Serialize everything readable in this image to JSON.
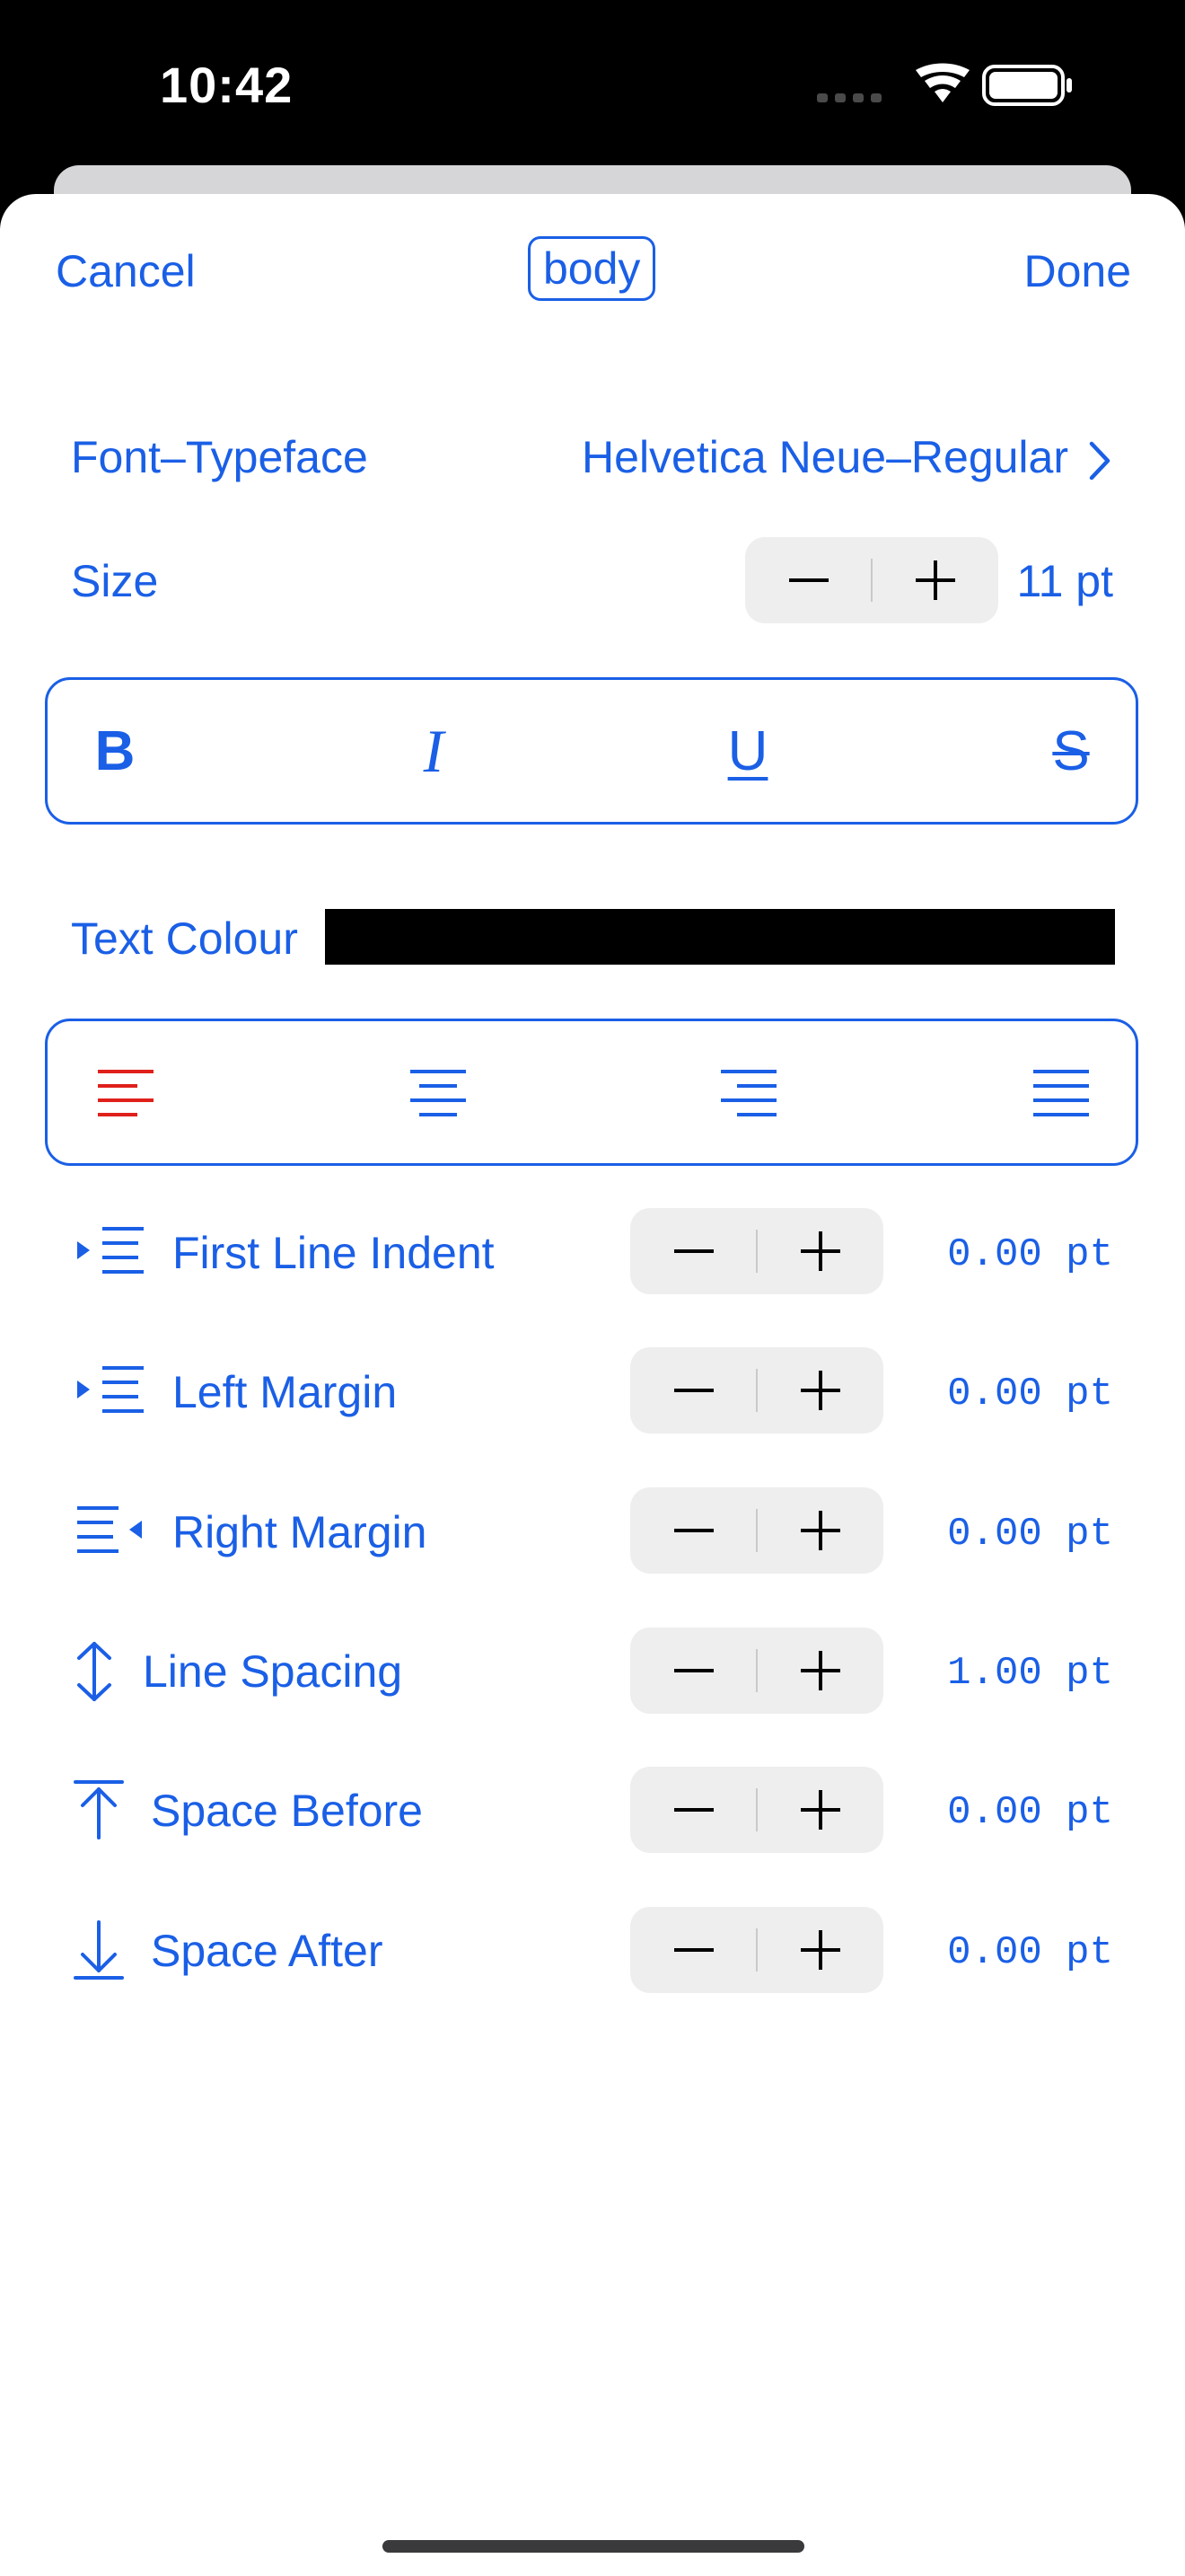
{
  "status_bar": {
    "time": "10:42"
  },
  "nav": {
    "cancel": "Cancel",
    "title": "body",
    "done": "Done"
  },
  "font": {
    "label": "Font–Typeface",
    "value": "Helvetica Neue–Regular"
  },
  "size": {
    "label": "Size",
    "value": "11 pt"
  },
  "format_buttons": {
    "bold": "B",
    "italic": "I",
    "underline": "U",
    "strike": "S"
  },
  "text_colour": {
    "label": "Text Colour",
    "color": "#000000"
  },
  "alignment": {
    "selected": "left",
    "options": [
      "left",
      "center",
      "right",
      "justify"
    ],
    "selected_color": "#e0201b"
  },
  "paragraph": [
    {
      "label": "First Line Indent",
      "value": "0.00 pt",
      "icon": "first-line-indent-icon"
    },
    {
      "label": "Left Margin",
      "value": "0.00 pt",
      "icon": "left-margin-icon"
    },
    {
      "label": "Right Margin",
      "value": "0.00 pt",
      "icon": "right-margin-icon"
    },
    {
      "label": "Line Spacing",
      "value": "1.00 pt",
      "icon": "line-spacing-icon"
    },
    {
      "label": "Space Before",
      "value": "0.00 pt",
      "icon": "space-before-icon"
    },
    {
      "label": "Space After",
      "value": "0.00 pt",
      "icon": "space-after-icon"
    }
  ],
  "colors": {
    "accent": "#1a5fe6",
    "stepper_bg": "#eeeeef"
  }
}
